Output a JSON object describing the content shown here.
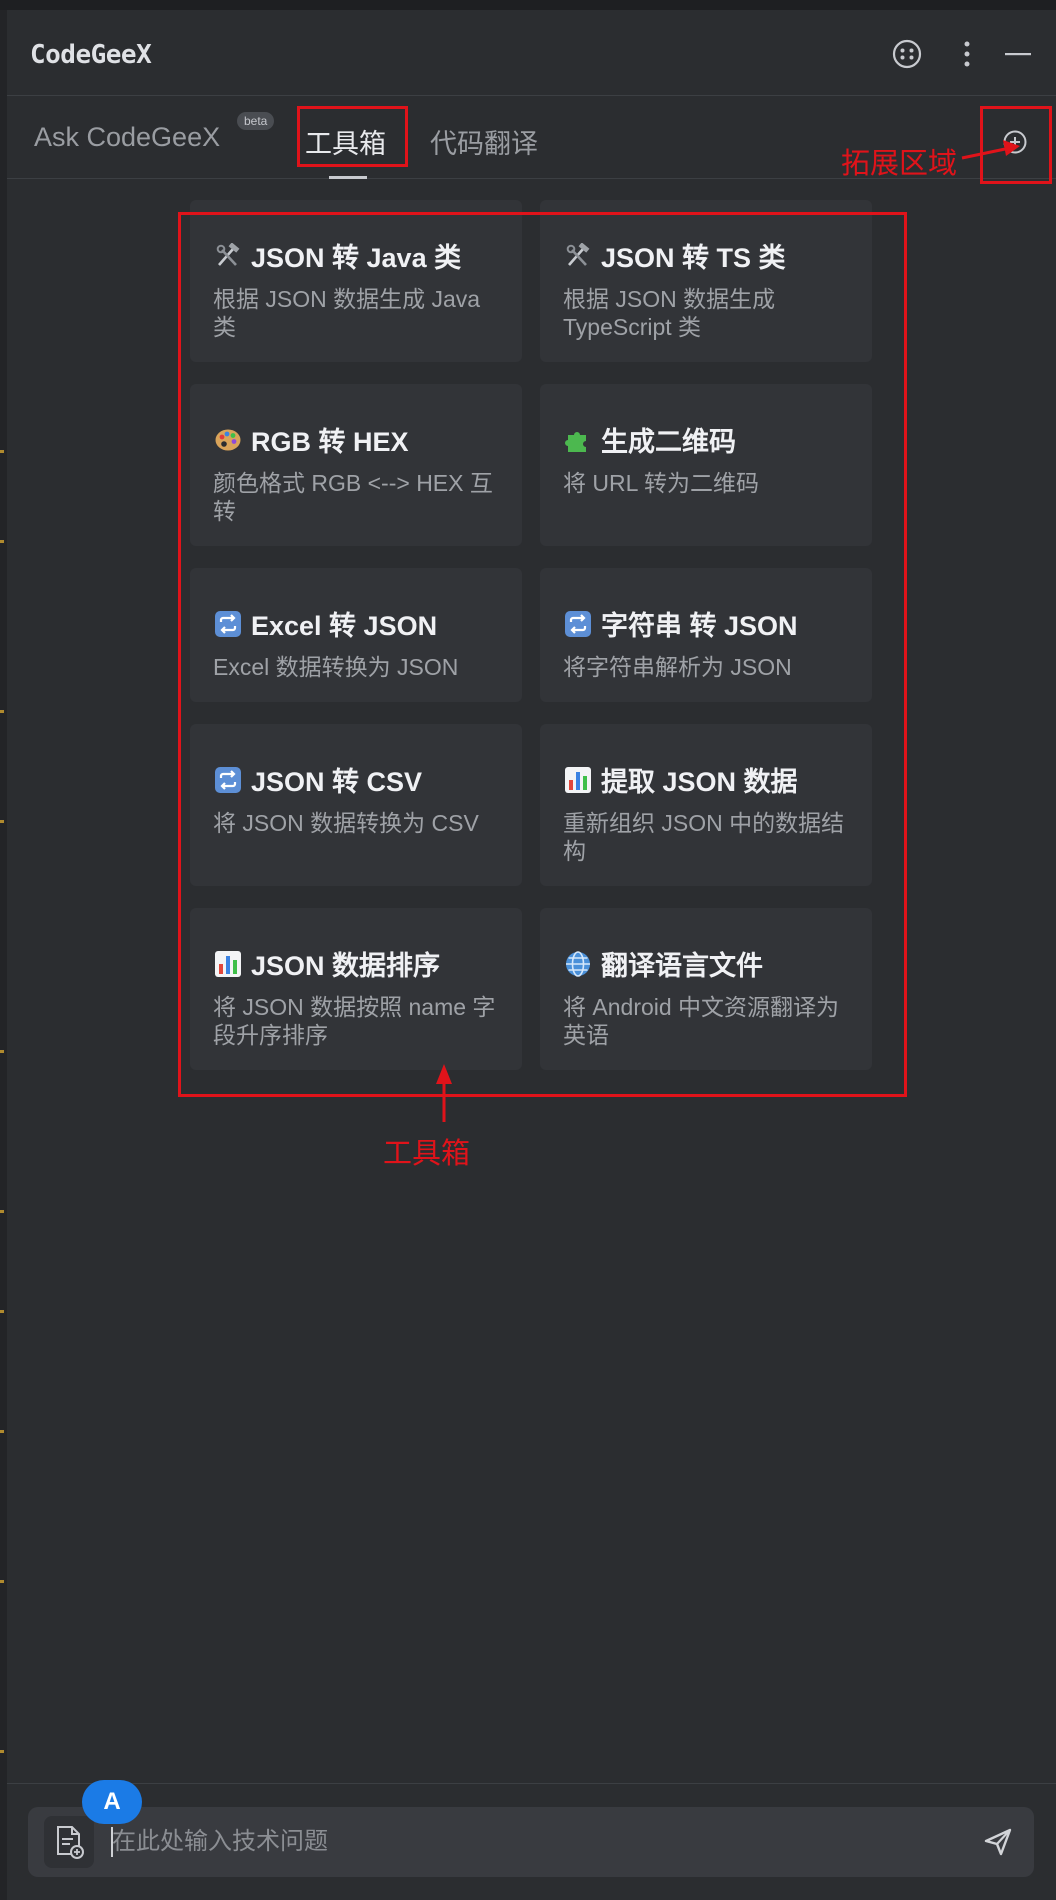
{
  "header": {
    "title": "CodeGeeX",
    "icons": [
      "copilot-icon",
      "more-vertical-icon",
      "minimize-icon"
    ]
  },
  "tabs": [
    {
      "label": "Ask CodeGeeX",
      "badge": "beta"
    },
    {
      "label": "工具箱",
      "selected": true
    },
    {
      "label": "代码翻译"
    }
  ],
  "tools": [
    {
      "icon": "hammer-wrench-icon",
      "title": "JSON 转 Java 类",
      "desc": "根据 JSON 数据生成 Java 类"
    },
    {
      "icon": "hammer-wrench-icon",
      "title": "JSON 转 TS 类",
      "desc": "根据 JSON 数据生成 TypeScript 类"
    },
    {
      "icon": "palette-icon",
      "title": "RGB 转 HEX",
      "desc": "颜色格式 RGB <--> HEX 互转"
    },
    {
      "icon": "puzzle-icon",
      "title": "生成二维码",
      "desc": "将 URL 转为二维码"
    },
    {
      "icon": "repeat-icon",
      "title": "Excel 转 JSON",
      "desc": "Excel 数据转换为 JSON"
    },
    {
      "icon": "repeat-icon",
      "title": "字符串 转 JSON",
      "desc": "将字符串解析为 JSON"
    },
    {
      "icon": "repeat-icon",
      "title": "JSON 转 CSV",
      "desc": "将 JSON 数据转换为 CSV"
    },
    {
      "icon": "bar-chart-icon",
      "title": "提取 JSON 数据",
      "desc": "重新组织 JSON 中的数据结构"
    },
    {
      "icon": "bar-chart-icon",
      "title": "JSON 数据排序",
      "desc": "将 JSON 数据按照 name 字段升序排序"
    },
    {
      "icon": "globe-icon",
      "title": "翻译语言文件",
      "desc": "将 Android 中文资源翻译为英语"
    }
  ],
  "annotations": {
    "extension_label": "拓展区域",
    "toolbox_label": "工具箱",
    "color": "#e0131a"
  },
  "composer": {
    "avatar_letter": "A",
    "placeholder": "在此处输入技术问题",
    "value": ""
  },
  "colors": {
    "background": "#2b2d30",
    "card": "#323438",
    "avatar": "#1b7be6"
  }
}
